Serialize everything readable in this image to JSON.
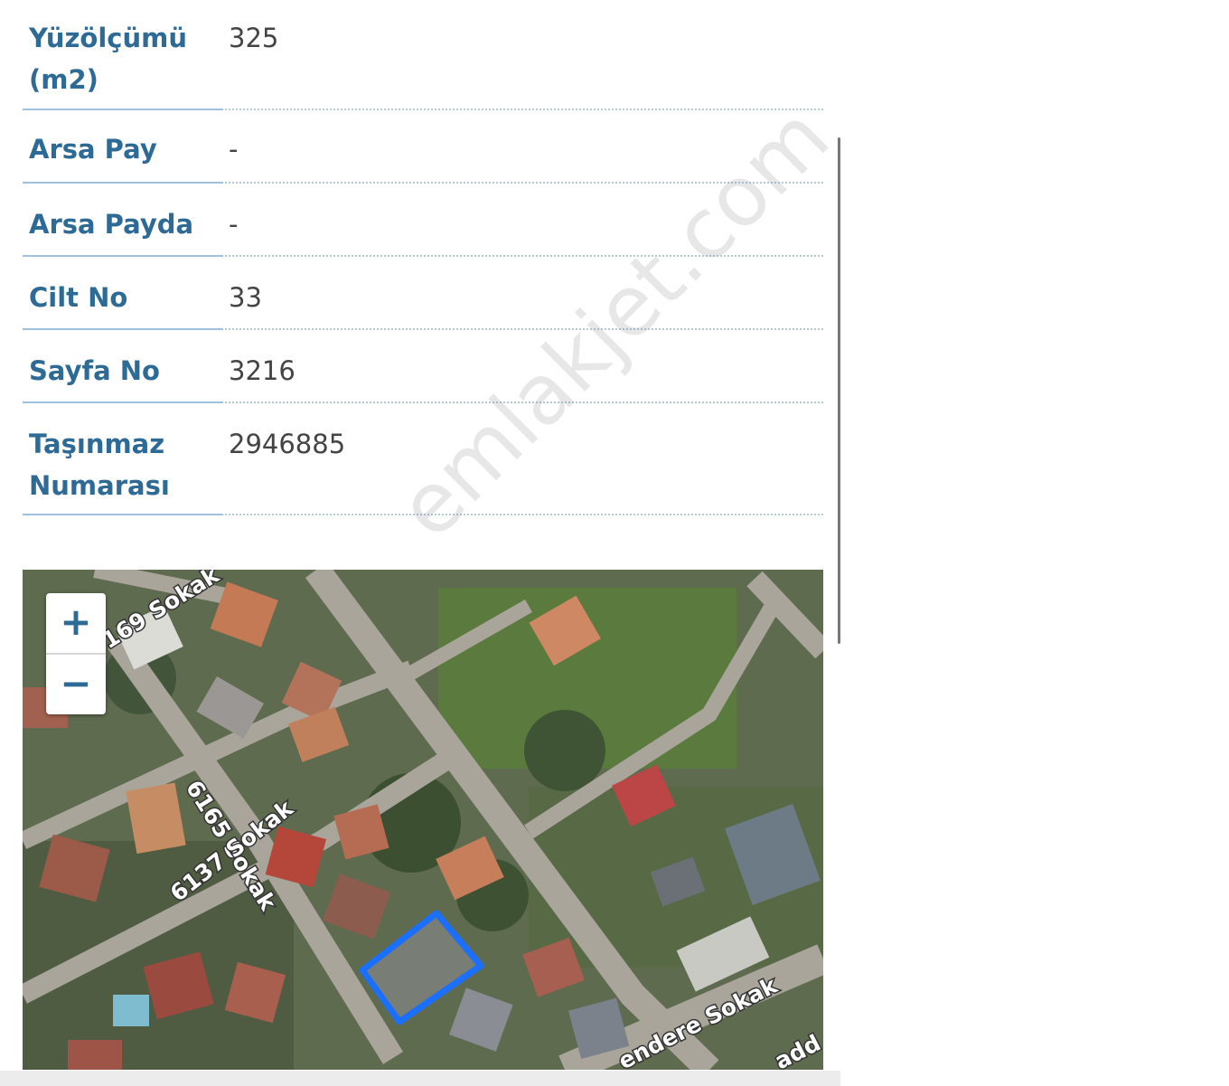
{
  "details": [
    {
      "label_line1": "Yüzölçümü",
      "label_line2": "(m2)",
      "value": "325"
    },
    {
      "label_line1": "Arsa Pay",
      "label_line2": "",
      "value": "-"
    },
    {
      "label_line1": "Arsa Payda",
      "label_line2": "",
      "value": "-"
    },
    {
      "label_line1": "Cilt No",
      "label_line2": "",
      "value": "33"
    },
    {
      "label_line1": "Sayfa No",
      "label_line2": "",
      "value": "3216"
    },
    {
      "label_line1": "Taşınmaz",
      "label_line2": "Numarası",
      "value": "2946885"
    }
  ],
  "map": {
    "zoom_in": "+",
    "zoom_out": "−",
    "streets": {
      "s1": "169 Sokak",
      "s2": "6165 Sokak",
      "s3": "6137 Sokak",
      "s4": "endere Sokak",
      "s5": "add"
    },
    "parcel_color": "#1a6fff"
  },
  "watermark": "emlakjet.com"
}
